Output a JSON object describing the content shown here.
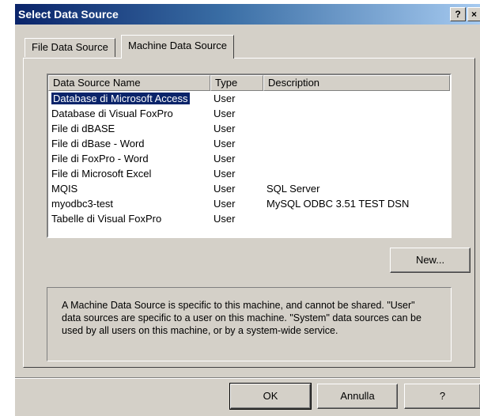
{
  "window": {
    "title": "Select Data Source",
    "help_button": "?",
    "close_button": "×"
  },
  "tabs": [
    {
      "label": "File Data Source",
      "active": false
    },
    {
      "label": "Machine Data Source",
      "active": true
    }
  ],
  "list": {
    "columns": [
      "Data Source Name",
      "Type",
      "Description"
    ],
    "rows": [
      {
        "name": "Database di Microsoft Access",
        "type": "User",
        "description": "",
        "selected": true
      },
      {
        "name": "Database di Visual FoxPro",
        "type": "User",
        "description": ""
      },
      {
        "name": "File di dBASE",
        "type": "User",
        "description": ""
      },
      {
        "name": "File di dBase - Word",
        "type": "User",
        "description": ""
      },
      {
        "name": "File di FoxPro - Word",
        "type": "User",
        "description": ""
      },
      {
        "name": "File di Microsoft Excel",
        "type": "User",
        "description": ""
      },
      {
        "name": "MQIS",
        "type": "User",
        "description": "SQL Server"
      },
      {
        "name": "myodbc3-test",
        "type": "User",
        "description": "MySQL ODBC 3.51 TEST DSN"
      },
      {
        "name": "Tabelle di Visual FoxPro",
        "type": "User",
        "description": ""
      }
    ]
  },
  "new_button": "New...",
  "info_text": "A Machine Data Source is specific to this machine, and cannot be shared. \"User\" data sources are specific to a user on this machine. \"System\" data sources can be used by all users on this machine, or by a system-wide service.",
  "footer": {
    "ok": "OK",
    "cancel": "Annulla",
    "help": "?"
  }
}
